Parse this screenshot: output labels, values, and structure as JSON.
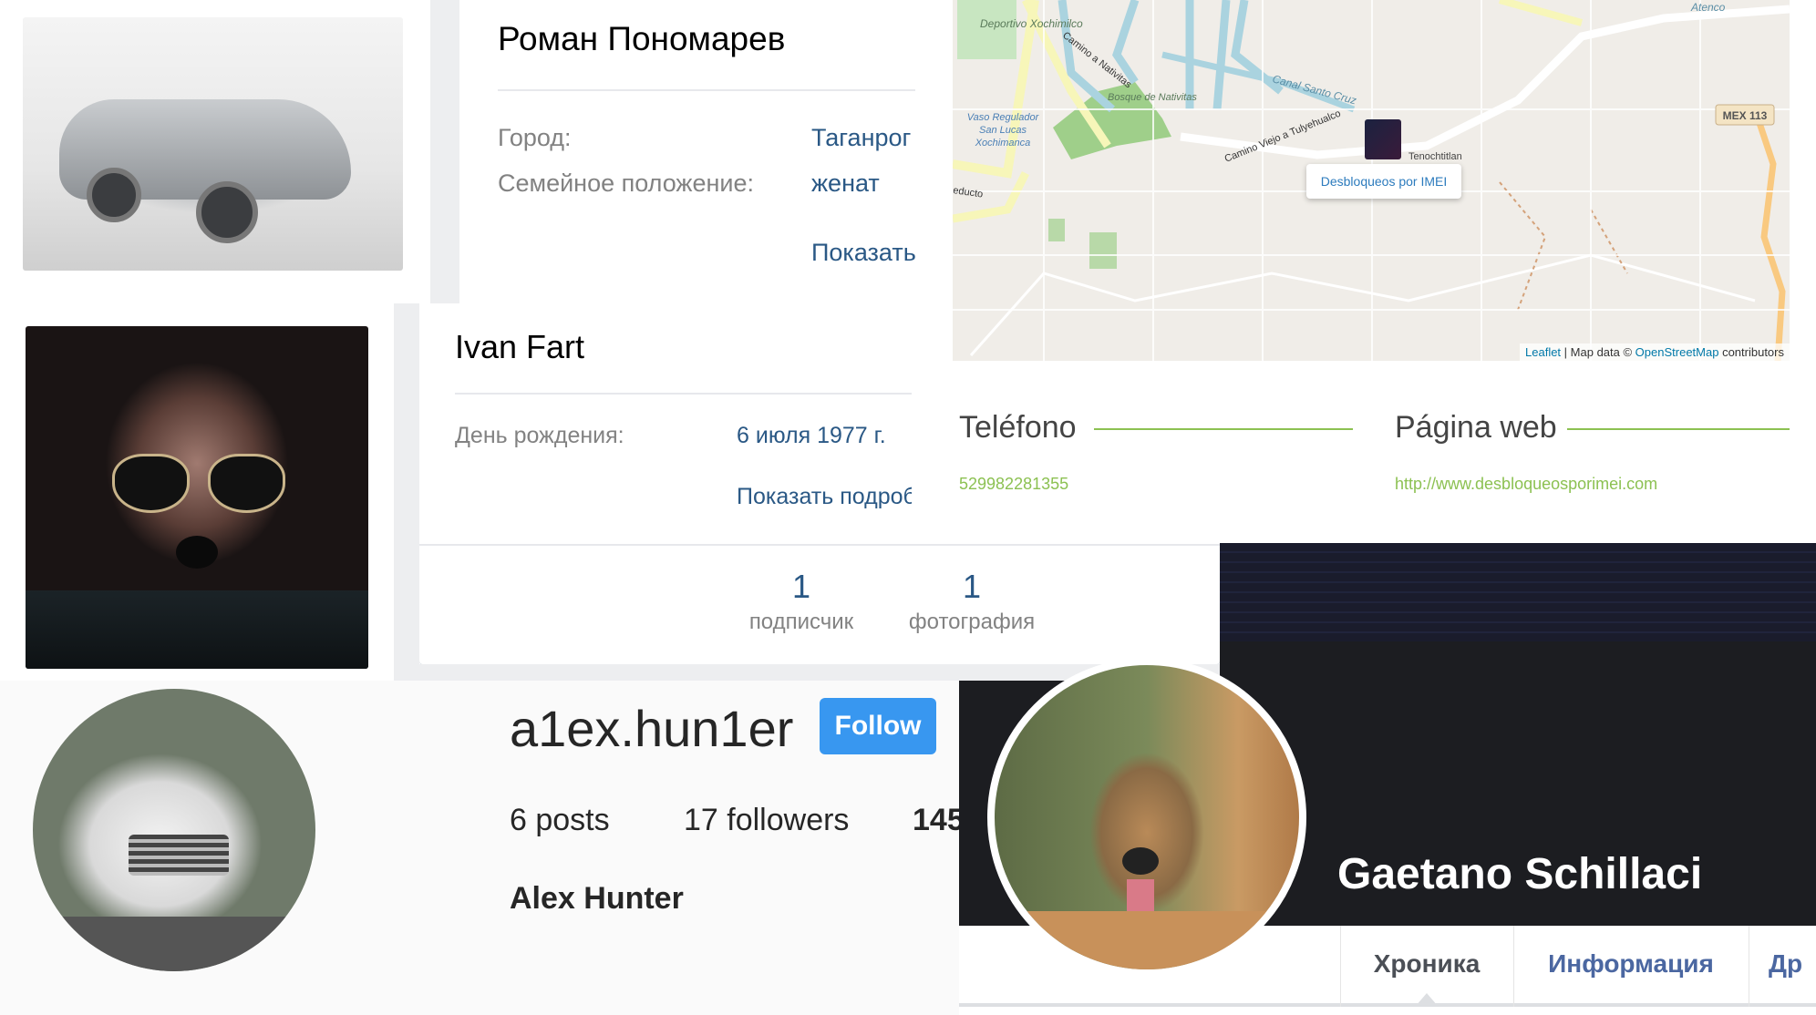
{
  "vk_profile_1": {
    "name": "Роман Пономарев",
    "fields": [
      {
        "label": "Город:",
        "value": "Таганрог"
      },
      {
        "label": "Семейное положение:",
        "value": "женат"
      }
    ],
    "show_more": "Показать"
  },
  "vk_profile_2": {
    "name": "Ivan Fart",
    "fields": [
      {
        "label": "День рождения:",
        "value": "6 июля 1977 г."
      }
    ],
    "show_more": "Показать подроб",
    "counters": [
      {
        "count": "1",
        "label": "подписчик"
      },
      {
        "count": "1",
        "label": "фотография"
      }
    ]
  },
  "map": {
    "popup": "Desbloqueos por IMEI",
    "attribution": {
      "leaflet": "Leaflet",
      "separator": " | Map data © ",
      "osm": "OpenStreetMap",
      "suffix": " contributors"
    },
    "labels": [
      "Deportivo Xochimilco",
      "Camino a Nativitas",
      "Canal Santo Cruz",
      "Bosque de Nativitas",
      "Vaso Regulador San Lucas Xochimanca",
      "Camino Viejo a Tulyehualco",
      "Tenochtitlan",
      "MEX 113",
      "Atenco",
      "educto"
    ]
  },
  "business": {
    "phone_heading": "Teléfono",
    "phone": "529982281355",
    "web_heading": "Página web",
    "web": "http://www.desbloqueosporimei.com",
    "accent": "#8cc152"
  },
  "instagram": {
    "username": "a1ex.hun1er",
    "follow_label": "Follow",
    "stats": {
      "posts": "6 posts",
      "followers": "17 followers",
      "following": "145"
    },
    "full_name": "Alex Hunter",
    "accent": "#3897f0"
  },
  "facebook": {
    "name": "Gaetano Schillaci",
    "tabs": [
      "Хроника",
      "Информация",
      "Др"
    ],
    "tab_color": "#4b67a1"
  }
}
